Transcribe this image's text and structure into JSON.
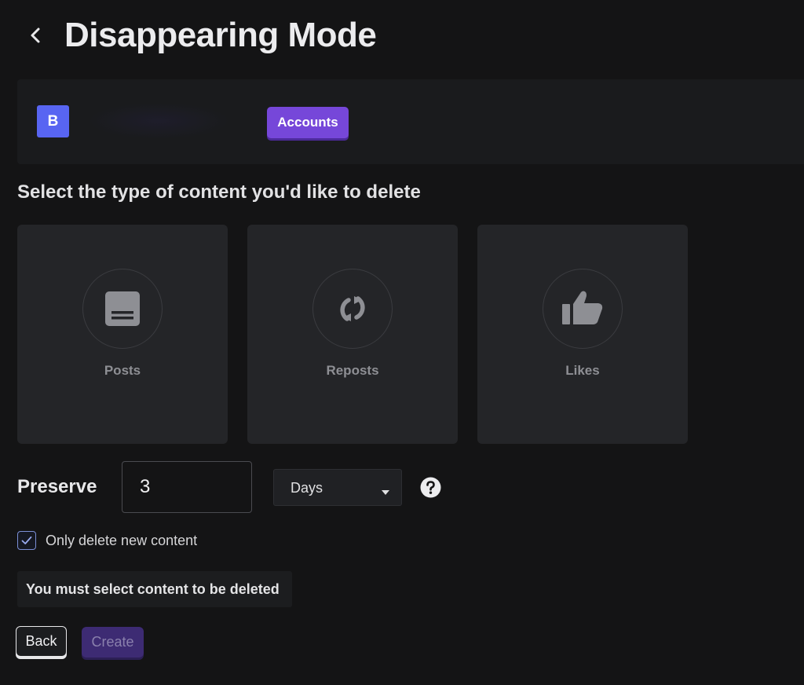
{
  "header": {
    "title": "Disappearing Mode",
    "back_icon": "chevron-left-icon"
  },
  "account": {
    "avatar_letter": "B",
    "accounts_button_label": "Accounts"
  },
  "content_selection": {
    "heading": "Select the type of content you'd like to delete",
    "options": [
      {
        "label": "Posts",
        "icon": "post-icon"
      },
      {
        "label": "Reposts",
        "icon": "repost-icon"
      },
      {
        "label": "Likes",
        "icon": "thumbs-up-icon"
      }
    ]
  },
  "preserve": {
    "label": "Preserve",
    "value": "3",
    "unit": "Days",
    "help_icon": "question-mark-icon"
  },
  "checkbox": {
    "label": "Only delete new content",
    "checked": true
  },
  "warning": {
    "text": "You must select content to be deleted"
  },
  "actions": {
    "back_label": "Back",
    "create_label": "Create",
    "create_disabled": true
  },
  "colors": {
    "accent": "#7647d9",
    "avatar": "#5865f2",
    "background": "#141415",
    "card": "#242528"
  }
}
